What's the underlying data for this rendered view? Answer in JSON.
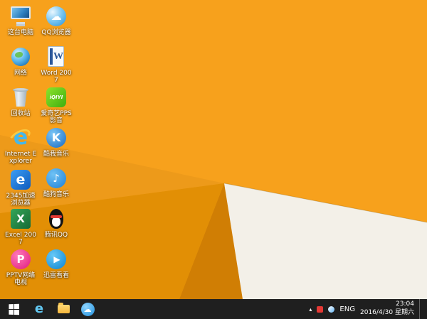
{
  "desktop": {
    "icons": [
      {
        "label": "这台电脑",
        "icon": "computer"
      },
      {
        "label": "QQ浏览器",
        "icon": "qq-browser"
      },
      {
        "label": "网络",
        "icon": "network"
      },
      {
        "label": "Word 2007",
        "icon": "word"
      },
      {
        "label": "回收站",
        "icon": "recycle-bin"
      },
      {
        "label": "爱奇艺PPS影音",
        "icon": "iqiyi"
      },
      {
        "label": "Internet Explorer",
        "icon": "internet-explorer"
      },
      {
        "label": "酷我音乐",
        "icon": "kuwo"
      },
      {
        "label": "2345加速浏览器",
        "icon": "browser-2345"
      },
      {
        "label": "酷狗音乐",
        "icon": "kugou"
      },
      {
        "label": "Excel 2007",
        "icon": "excel"
      },
      {
        "label": "腾讯QQ",
        "icon": "tencent-qq"
      },
      {
        "label": "PPTV网络电视",
        "icon": "pptv"
      },
      {
        "label": "迅雷看看",
        "icon": "xunlei"
      }
    ]
  },
  "taskbar": {
    "apps": [
      {
        "name": "internet-explorer"
      },
      {
        "name": "file-explorer"
      },
      {
        "name": "cloud-app"
      }
    ],
    "tray": {
      "overflow_arrow": "▴",
      "lang": "ENG",
      "time": "23:04",
      "date": "2016/4/30 星期六"
    }
  },
  "glyphs": {
    "ie": "e",
    "excel": "X",
    "word": "W",
    "pptv": "P",
    "kuwo": "K",
    "kugou": "♪",
    "xunlei": "▶",
    "iqiyi": "iQIYI",
    "e2345": "e",
    "cloud": "☁"
  },
  "colors": {
    "wp-orange": "#F7A11C",
    "wp-dark": "#E28F05",
    "wp-deep": "#D07E04",
    "wp-cream": "#F3F0E8",
    "taskbar-bg": "#1F1F1F"
  }
}
